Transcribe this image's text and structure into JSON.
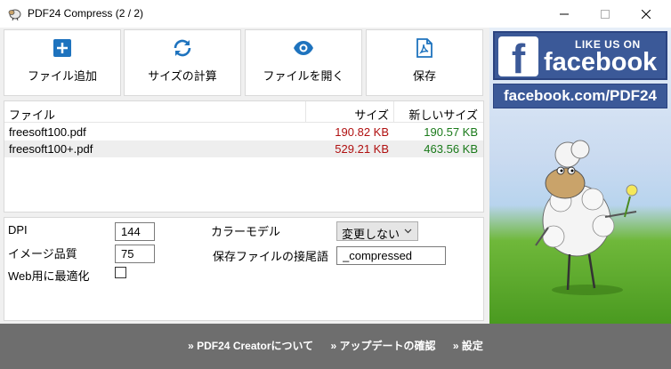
{
  "window": {
    "title": "PDF24 Compress (2 / 2)"
  },
  "toolbar": {
    "add_file": "ファイル追加",
    "calc_size": "サイズの計算",
    "open_file": "ファイルを開く",
    "save": "保存"
  },
  "file_list": {
    "headers": {
      "file": "ファイル",
      "size": "サイズ",
      "new_size": "新しいサイズ"
    },
    "rows": [
      {
        "name": "freesoft100.pdf",
        "size": "190.82 KB",
        "new_size": "190.57 KB"
      },
      {
        "name": "freesoft100+.pdf",
        "size": "529.21 KB",
        "new_size": "463.56 KB"
      }
    ],
    "selected_row": 1
  },
  "settings": {
    "dpi_label": "DPI",
    "dpi_value": "144",
    "quality_label": "イメージ品質",
    "quality_value": "75",
    "web_opt_label": "Web用に最適化",
    "web_opt_checked": false,
    "color_model_label": "カラーモデル",
    "color_model_value": "変更しない",
    "suffix_label": "保存ファイルの接尾語",
    "suffix_value": "_compressed"
  },
  "ad": {
    "like_us": "LIKE US ON",
    "brand": "facebook",
    "url": "facebook.com/PDF24"
  },
  "footer": {
    "about": "» PDF24 Creatorについて",
    "update": "» アップデートの確認",
    "settings": "» 設定"
  },
  "colors": {
    "accent_blue": "#1e73be",
    "size_red": "#b01010",
    "size_green": "#1a7a1a",
    "facebook": "#3b5998",
    "footer_bg": "#6e6e6e"
  }
}
